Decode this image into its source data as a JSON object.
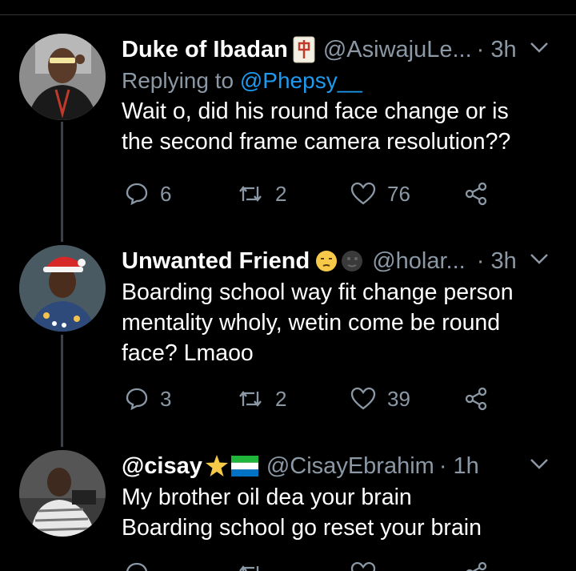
{
  "tweets": [
    {
      "name": "Duke of Ibadan",
      "handle": "@AsiwajuLe...",
      "time": "· 3h",
      "replying_prefix": "Replying to ",
      "replying_to": "@Phepsy__",
      "text_lines": [
        "Wait o, did his round face change or is",
        "the second frame camera resolution??"
      ],
      "replies": "6",
      "retweets": "2",
      "likes": "76"
    },
    {
      "name": "Unwanted Friend",
      "handle": "@holar...",
      "time": "· 3h",
      "text_lines": [
        "Boarding school way fit change person",
        "mentality wholy, wetin come be round",
        "face? Lmaoo"
      ],
      "replies": "3",
      "retweets": "2",
      "likes": "39"
    },
    {
      "name": "@cisay",
      "handle": "@CisayEbrahim",
      "time": "· 1h",
      "text_lines": [
        "My brother oil dea your brain",
        "Boarding school go reset your brain"
      ]
    }
  ],
  "colors": {
    "background": "#000000",
    "secondary_text": "#8b98a5",
    "link": "#1d9bf0",
    "thread_line": "#3d4145"
  },
  "icons": {
    "reply": "reply-icon",
    "retweet": "retweet-icon",
    "like": "heart-icon",
    "share": "share-icon",
    "menu": "chevron-down-icon"
  }
}
